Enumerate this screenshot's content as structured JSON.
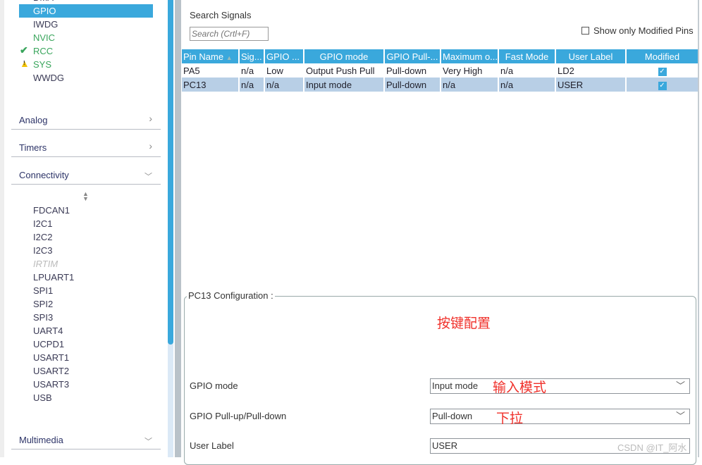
{
  "sidebar": {
    "peripherals_system": [
      {
        "label": "GPIO",
        "state": "selected"
      },
      {
        "label": "IWDG",
        "state": "normal"
      },
      {
        "label": "NVIC",
        "state": "configured"
      },
      {
        "label": "RCC",
        "state": "ok",
        "icon": "check-icon"
      },
      {
        "label": "SYS",
        "state": "warning",
        "icon": "warning-icon"
      },
      {
        "label": "WWDG",
        "state": "normal"
      }
    ],
    "categories": {
      "analog": "Analog",
      "timers": "Timers",
      "connectivity": "Connectivity",
      "multimedia": "Multimedia"
    },
    "connectivity_items": [
      "FDCAN1",
      "I2C1",
      "I2C2",
      "I2C3",
      "IRTIM",
      "LPUART1",
      "SPI1",
      "SPI2",
      "SPI3",
      "UART4",
      "UCPD1",
      "USART1",
      "USART2",
      "USART3",
      "USB"
    ]
  },
  "search": {
    "label": "Search Signals",
    "placeholder": "Search (Crtl+F)",
    "show_modified_label": "Show only Modified Pins",
    "show_modified_checked": false
  },
  "table": {
    "headers": [
      "Pin Name",
      "Sig...",
      "GPIO ...",
      "GPIO mode",
      "GPIO Pull-...",
      "Maximum o...",
      "Fast Mode",
      "User Label",
      "Modified"
    ],
    "rows": [
      [
        "PA5",
        "n/a",
        "Low",
        "Output Push Pull",
        "Pull-down",
        "Very High",
        "n/a",
        "LD2"
      ],
      [
        "PC13",
        "n/a",
        "n/a",
        "Input mode",
        "Pull-down",
        "n/a",
        "n/a",
        "USER"
      ]
    ],
    "modified": [
      true,
      true
    ],
    "selected_row": 1
  },
  "config": {
    "title": "PC13 Configuration :",
    "annotation_title": "按键配置",
    "gpio_mode_label": "GPIO mode",
    "gpio_mode_value": "Input mode",
    "gpio_mode_note": "输入模式",
    "pull_label": "GPIO Pull-up/Pull-down",
    "pull_value": "Pull-down",
    "pull_note": "下拉",
    "user_label_label": "User Label",
    "user_label_value": "USER"
  },
  "watermark": "CSDN @IT_阿水",
  "colors": {
    "accent": "#3aa8dc",
    "selected_row": "#b8cfe6",
    "configured": "#39a55c",
    "annotation": "#f0302a"
  }
}
